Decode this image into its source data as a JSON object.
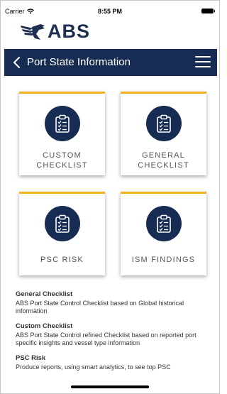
{
  "status_bar": {
    "carrier": "Carrier",
    "time": "8:55 PM"
  },
  "brand": {
    "logo_text": "ABS",
    "primary_color": "#172c52",
    "accent_color": "#f0b323"
  },
  "header": {
    "title": "Port State Information",
    "back_icon": "chevron-left-icon",
    "menu_icon": "hamburger-menu-icon"
  },
  "tiles": [
    {
      "line1": "CUSTOM",
      "line2": "CHECKLIST",
      "icon": "clipboard-checklist-icon"
    },
    {
      "line1": "GENERAL",
      "line2": "CHECKLIST",
      "icon": "clipboard-checklist-icon"
    },
    {
      "line1": "PSC RISK",
      "line2": "",
      "icon": "clipboard-checklist-icon"
    },
    {
      "line1": "ISM FINDINGS",
      "line2": "",
      "icon": "clipboard-checklist-icon"
    }
  ],
  "descriptions": [
    {
      "title": "General Checklist",
      "text": "ABS Port State Control Checklist based on Global historical information"
    },
    {
      "title": "Custom Checklist",
      "text": "ABS Port State Control refined Checklist based on reported port specific insights and vessel type information"
    },
    {
      "title": "PSC Risk",
      "text": "Produce reports, using smart analytics, to see top PSC"
    }
  ]
}
